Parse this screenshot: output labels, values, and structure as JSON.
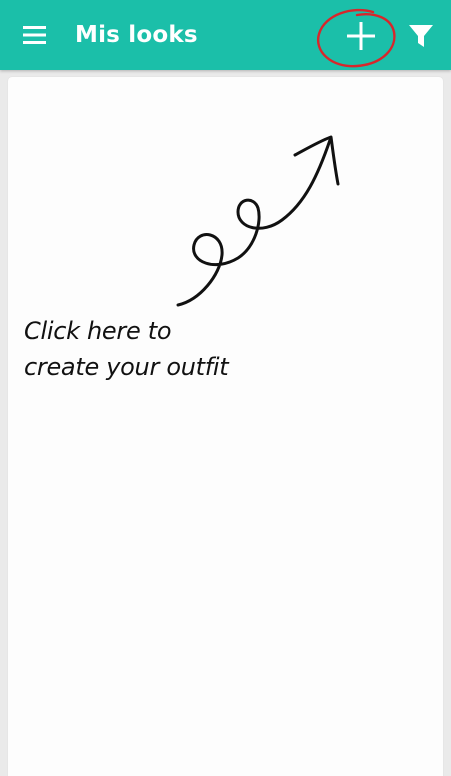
{
  "app_bar": {
    "title": "Mis looks",
    "menu_icon": "hamburger-menu-icon",
    "add_icon": "plus-icon",
    "filter_icon": "filter-funnel-icon",
    "background_color": "#1bbfa9",
    "highlight_color": "#d8262b"
  },
  "hint": {
    "line1": "Click here to",
    "line2": "create your outfit"
  }
}
